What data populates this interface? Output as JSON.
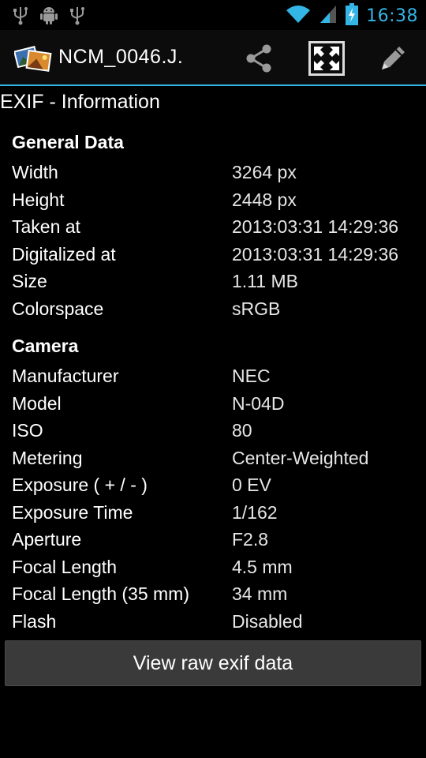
{
  "status_bar": {
    "time": "16:38",
    "accent": "#33b5e5",
    "icons": [
      "usb-icon",
      "android-debug-icon",
      "usb-icon",
      "wifi-icon",
      "signal-icon",
      "battery-charging-icon"
    ]
  },
  "action_bar": {
    "title": "NCM_0046.J.",
    "actions": [
      "share-icon",
      "fullscreen-icon",
      "edit-icon"
    ]
  },
  "section_title": "EXIF - Information",
  "groups": {
    "general": {
      "title": "General Data",
      "rows": [
        {
          "label": "Width",
          "value": "3264 px"
        },
        {
          "label": "Height",
          "value": "2448 px"
        },
        {
          "label": "Taken at",
          "value": "2013:03:31 14:29:36"
        },
        {
          "label": "Digitalized at",
          "value": "2013:03:31 14:29:36"
        },
        {
          "label": "Size",
          "value": "1.11 MB"
        },
        {
          "label": "Colorspace",
          "value": "sRGB"
        }
      ]
    },
    "camera": {
      "title": "Camera",
      "rows": [
        {
          "label": "Manufacturer",
          "value": "NEC"
        },
        {
          "label": "Model",
          "value": "N-04D"
        },
        {
          "label": "ISO",
          "value": "80"
        },
        {
          "label": "Metering",
          "value": "Center-Weighted"
        },
        {
          "label": "Exposure ( + / - )",
          "value": "0 EV"
        },
        {
          "label": "Exposure Time",
          "value": "1/162"
        },
        {
          "label": "Aperture",
          "value": "F2.8"
        },
        {
          "label": "Focal Length",
          "value": "4.5 mm"
        },
        {
          "label": "Focal Length (35 mm)",
          "value": "34 mm"
        },
        {
          "label": "Flash",
          "value": "Disabled"
        }
      ]
    }
  },
  "buttons": {
    "view_raw": "View raw exif data"
  }
}
